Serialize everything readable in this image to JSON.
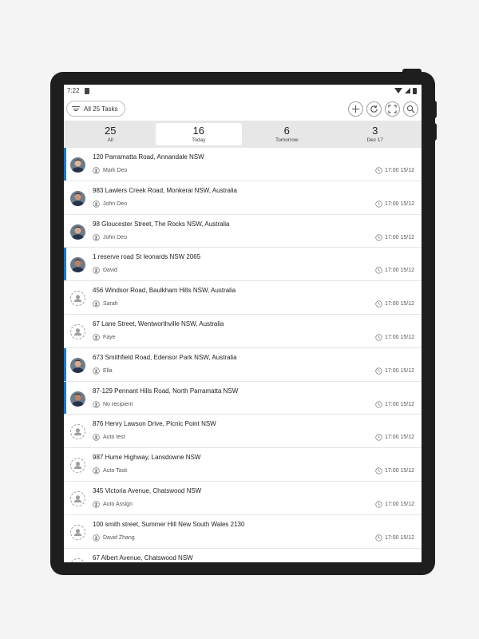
{
  "status_bar": {
    "time": "7:22"
  },
  "toolbar": {
    "filter_label": "All 25 Tasks",
    "actions": [
      "plus-icon",
      "refresh-icon",
      "fullscreen-icon",
      "search-icon"
    ]
  },
  "date_tabs": [
    {
      "count": "25",
      "label": "All",
      "active": false
    },
    {
      "count": "16",
      "label": "Today",
      "active": true
    },
    {
      "count": "6",
      "label": "Tomorrow",
      "active": false
    },
    {
      "count": "3",
      "label": "Dec 17",
      "active": false
    }
  ],
  "tasks": [
    {
      "address": "120 Parramatta Road, Annandale NSW",
      "recipient": "Mark Deo",
      "due": "17:00 15/12",
      "avatar": "photo",
      "accent": true
    },
    {
      "address": "983 Lawlers Creek Road, Monkerai NSW, Australia",
      "recipient": "John Deo",
      "due": "17:00 15/12",
      "avatar": "photo",
      "accent": false
    },
    {
      "address": "98 Gloucester Street, The Rocks NSW, Australia",
      "recipient": "John Deo",
      "due": "17:00 15/12",
      "avatar": "photo",
      "accent": false
    },
    {
      "address": "1 reserve road St leonards NSW 2065",
      "recipient": "David",
      "due": "17:00 15/12",
      "avatar": "photo",
      "accent": true
    },
    {
      "address": "456 Windsor Road, Baulkham Hills NSW, Australia",
      "recipient": "Sarah",
      "due": "17:00 15/12",
      "avatar": "empty",
      "accent": false
    },
    {
      "address": "67 Lane Street, Wentworthville NSW, Australia",
      "recipient": "Faye",
      "due": "17:00 15/12",
      "avatar": "empty",
      "accent": false
    },
    {
      "address": "673 Smithfield Road, Edensor Park NSW, Australia",
      "recipient": "Ella",
      "due": "17:00 15/12",
      "avatar": "photo",
      "accent": true
    },
    {
      "address": "87-129 Pennant Hills Road, North Parramatta NSW",
      "recipient": "No recipient",
      "due": "17:00 15/12",
      "avatar": "photo",
      "accent": true
    },
    {
      "address": "876 Henry Lawson Drive, Picnic Point NSW",
      "recipient": "Auto test",
      "due": "17:00 15/12",
      "avatar": "empty",
      "accent": false
    },
    {
      "address": "987 Hume Highway, Lansdowne NSW",
      "recipient": "Auto Task",
      "due": "17:00 15/12",
      "avatar": "empty",
      "accent": false
    },
    {
      "address": "345 Victoria Avenue, Chatswood NSW",
      "recipient": "Auto Assign",
      "due": "17:00 15/12",
      "avatar": "empty",
      "accent": false
    },
    {
      "address": "100 smith street, Summer Hill New South Wales 2130",
      "recipient": "David Zhang",
      "due": "17:00 15/12",
      "avatar": "empty",
      "accent": false
    },
    {
      "address": "67 Albert Avenue, Chatswood NSW",
      "recipient": "",
      "due": "",
      "avatar": "empty",
      "accent": false
    }
  ],
  "colors": {
    "accent": "#1976d2",
    "device": "#1e1e1e",
    "datebar": "#e7e7e7"
  }
}
